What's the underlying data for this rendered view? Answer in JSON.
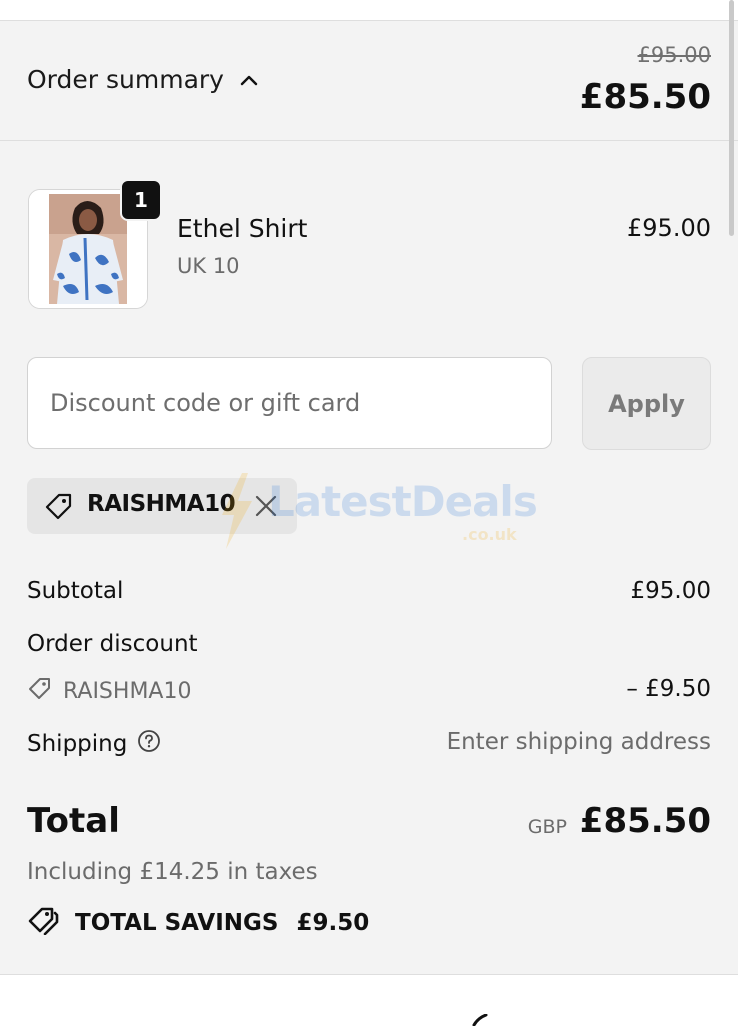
{
  "summary_header": {
    "toggle_label": "Order summary",
    "original_total": "£95.00",
    "discounted_total": "£85.50",
    "toggle_icon": "chevron-up-icon"
  },
  "line_item": {
    "name": "Ethel Shirt",
    "variant": "UK 10",
    "price": "£95.00",
    "quantity": "1",
    "image_icon": "product-thumbnail"
  },
  "discount": {
    "placeholder": "Discount code or gift card",
    "value": "",
    "apply_label": "Apply",
    "applied_code": "RAISHMA10",
    "remove_icon": "close-icon",
    "tag_icon": "tag-icon"
  },
  "watermark": {
    "brand": "LatestDeals",
    "suffix": ".co.uk"
  },
  "totals": {
    "subtotal_label": "Subtotal",
    "subtotal_value": "£95.00",
    "order_discount_label": "Order discount",
    "discount_code": "RAISHMA10",
    "discount_value": "– £9.50",
    "shipping_label": "Shipping",
    "shipping_value": "Enter shipping address",
    "shipping_help_icon": "question-circle-icon",
    "total_label": "Total",
    "currency": "GBP",
    "total_value": "£85.50",
    "taxes_note": "Including £14.25 in taxes",
    "savings_label": "TOTAL SAVINGS",
    "savings_value": "£9.50"
  },
  "colors": {
    "panel_background": "#f3f3f3",
    "text_primary": "#111111",
    "text_secondary": "#6b6b6b",
    "chip_background": "#e5e5e5",
    "apply_disabled": "#ebebeb"
  }
}
